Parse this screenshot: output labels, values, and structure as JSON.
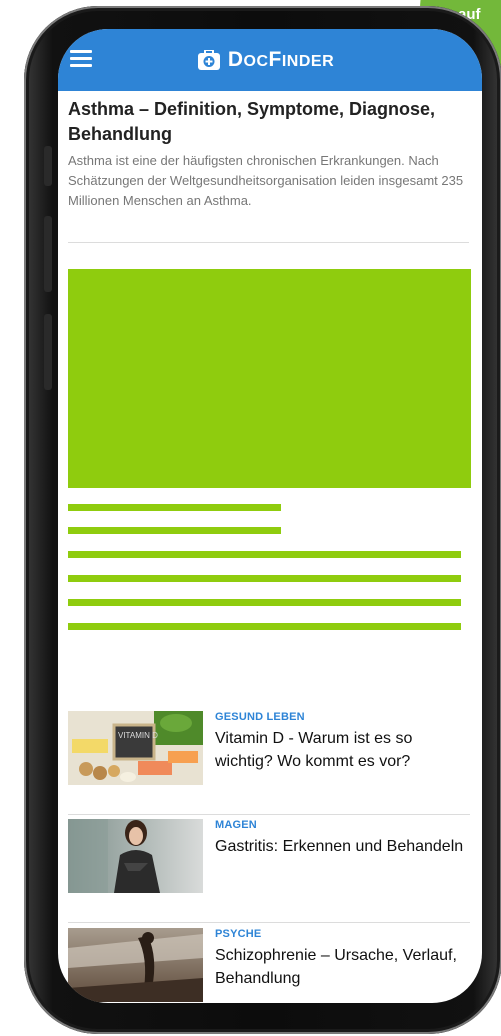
{
  "header": {
    "brand_prefix": "D",
    "brand_rest": "OC",
    "brand_prefix2": "F",
    "brand_rest2": "INDER",
    "menu_icon": "hamburger-menu-icon",
    "logo_icon": "medical-kit-icon",
    "color": "#2e84d6"
  },
  "corner_badge": {
    "text": "auf",
    "color": "#73b83a"
  },
  "article": {
    "title": "Asthma – Definition, Symptome, Diagnose, Behandlung",
    "description": "Asthma ist eine der häufigsten chronischen Erkrankungen. Nach Schätzungen der Weltgesundheitsorganisation leiden insgesamt 235 Millionen Menschen an Asthma."
  },
  "placeholder_color": "#8fcc0e",
  "related": [
    {
      "category": "GESUND LEBEN",
      "title": "Vitamin D - Warum ist es so wichtig? Wo kommt es vor?",
      "thumb_text": "VITAMIN D"
    },
    {
      "category": "MAGEN",
      "title": "Gastritis: Erkennen und Behandeln"
    },
    {
      "category": "PSYCHE",
      "title": "Schizophrenie – Ursache, Verlauf, Behandlung"
    }
  ]
}
